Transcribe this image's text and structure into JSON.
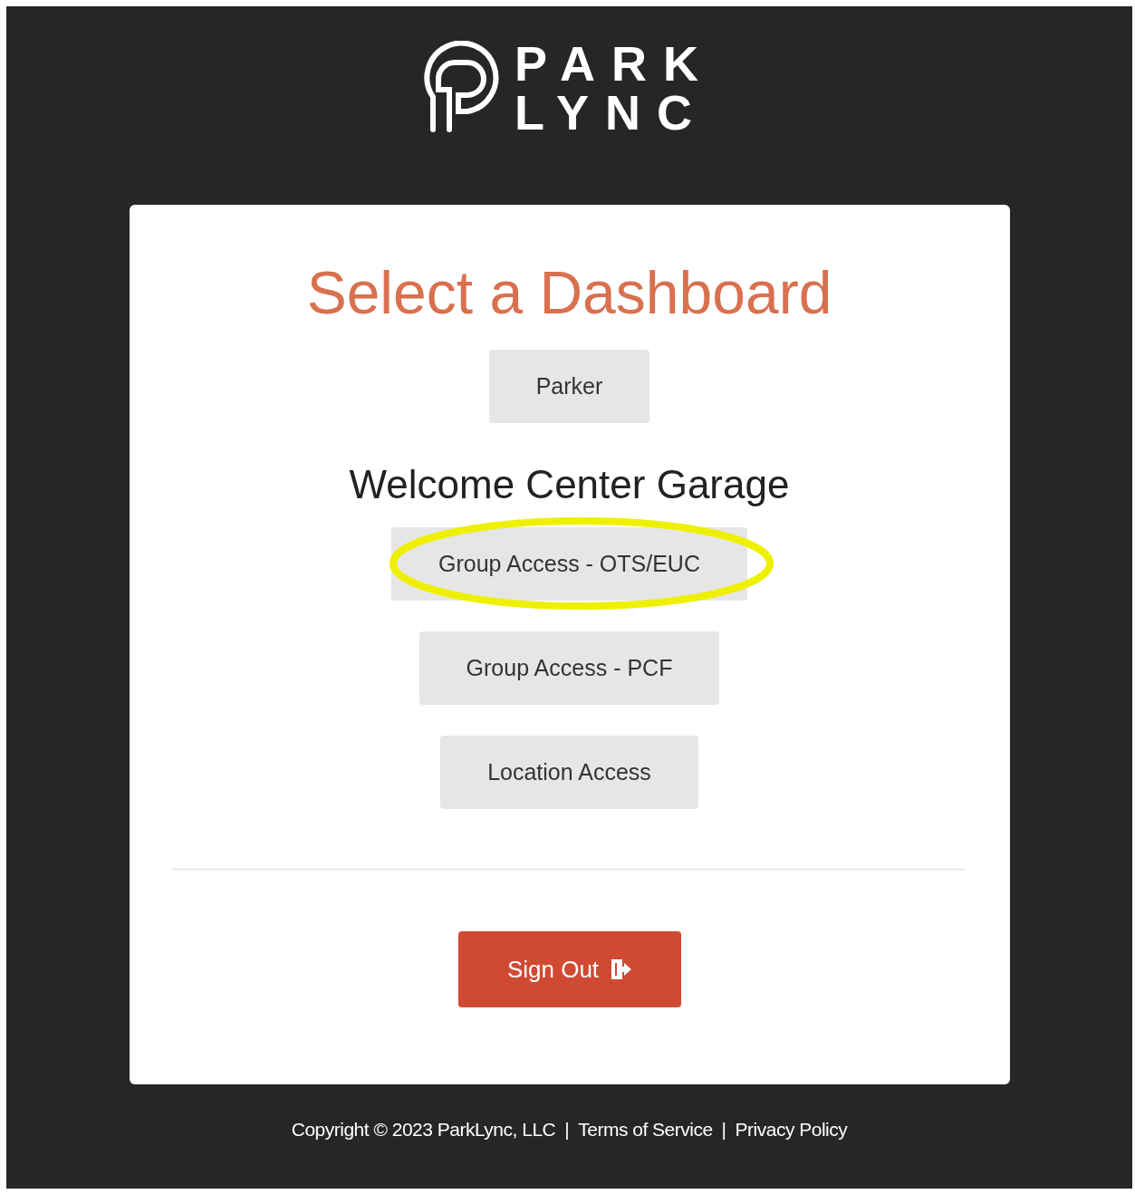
{
  "logo": {
    "line_1": "PARK",
    "line_2": "LYNC"
  },
  "card": {
    "title": "Select a Dashboard",
    "sections": [
      {
        "buttons": [
          {
            "label": "Parker",
            "highlighted": false
          }
        ]
      },
      {
        "heading": "Welcome Center Garage",
        "buttons": [
          {
            "label": "Group Access - OTS/EUC",
            "highlighted": true
          },
          {
            "label": "Group Access - PCF",
            "highlighted": false
          },
          {
            "label": "Location Access",
            "highlighted": false
          }
        ]
      }
    ],
    "sign_out": "Sign Out"
  },
  "footer": {
    "copyright": "Copyright © 2023 ParkLync, LLC",
    "separator_1": "|",
    "terms": "Terms of Service",
    "separator_2": "|",
    "privacy": "Privacy Policy"
  }
}
